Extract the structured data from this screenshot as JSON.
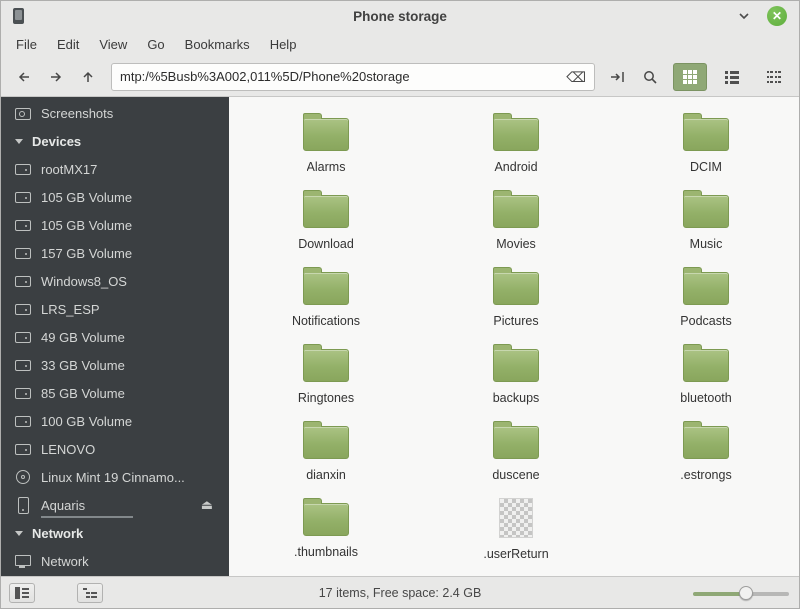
{
  "window": {
    "title": "Phone storage"
  },
  "menubar": {
    "items": [
      "File",
      "Edit",
      "View",
      "Go",
      "Bookmarks",
      "Help"
    ]
  },
  "toolbar": {
    "path": "mtp:/%5Busb%3A002,011%5D/Phone%20storage"
  },
  "icons": {
    "clear": "⌫",
    "eject": "⏏"
  },
  "sidebar": {
    "items": [
      {
        "type": "entry",
        "label": "Screenshots",
        "icon": "camera"
      },
      {
        "type": "header",
        "label": "Devices"
      },
      {
        "type": "entry",
        "label": "rootMX17",
        "icon": "drive"
      },
      {
        "type": "entry",
        "label": "105 GB Volume",
        "icon": "drive"
      },
      {
        "type": "entry",
        "label": "105 GB Volume",
        "icon": "drive"
      },
      {
        "type": "entry",
        "label": "157 GB Volume",
        "icon": "drive"
      },
      {
        "type": "entry",
        "label": "Windows8_OS",
        "icon": "drive"
      },
      {
        "type": "entry",
        "label": "LRS_ESP",
        "icon": "drive"
      },
      {
        "type": "entry",
        "label": "49 GB Volume",
        "icon": "drive"
      },
      {
        "type": "entry",
        "label": "33 GB Volume",
        "icon": "drive"
      },
      {
        "type": "entry",
        "label": "85 GB Volume",
        "icon": "drive"
      },
      {
        "type": "entry",
        "label": "100 GB Volume",
        "icon": "drive"
      },
      {
        "type": "entry",
        "label": "LENOVO",
        "icon": "drive"
      },
      {
        "type": "entry",
        "label": "Linux Mint 19 Cinnamo...",
        "icon": "disc"
      },
      {
        "type": "entry",
        "label": "Aquaris",
        "icon": "phone",
        "eject": true,
        "usage_bar": true
      },
      {
        "type": "header",
        "label": "Network"
      },
      {
        "type": "entry",
        "label": "Network",
        "icon": "network"
      }
    ]
  },
  "main": {
    "folders": [
      {
        "label": "Alarms",
        "icon": "folder"
      },
      {
        "label": "Android",
        "icon": "folder"
      },
      {
        "label": "DCIM",
        "icon": "folder"
      },
      {
        "label": "Download",
        "icon": "folder"
      },
      {
        "label": "Movies",
        "icon": "folder"
      },
      {
        "label": "Music",
        "icon": "folder"
      },
      {
        "label": "Notifications",
        "icon": "folder"
      },
      {
        "label": "Pictures",
        "icon": "folder"
      },
      {
        "label": "Podcasts",
        "icon": "folder"
      },
      {
        "label": "Ringtones",
        "icon": "folder"
      },
      {
        "label": "backups",
        "icon": "folder"
      },
      {
        "label": "bluetooth",
        "icon": "folder"
      },
      {
        "label": "dianxin",
        "icon": "folder"
      },
      {
        "label": "duscene",
        "icon": "folder"
      },
      {
        "label": ".estrongs",
        "icon": "folder"
      },
      {
        "label": ".thumbnails",
        "icon": "folder"
      },
      {
        "label": ".userReturn",
        "icon": "checker"
      }
    ]
  },
  "statusbar": {
    "text": "17 items, Free space: 2.4 GB"
  },
  "colors": {
    "accent": "#8fa876",
    "folder_green": "#93b068",
    "close_button": "#5eae3d",
    "sidebar_bg": "#3b3f42"
  }
}
